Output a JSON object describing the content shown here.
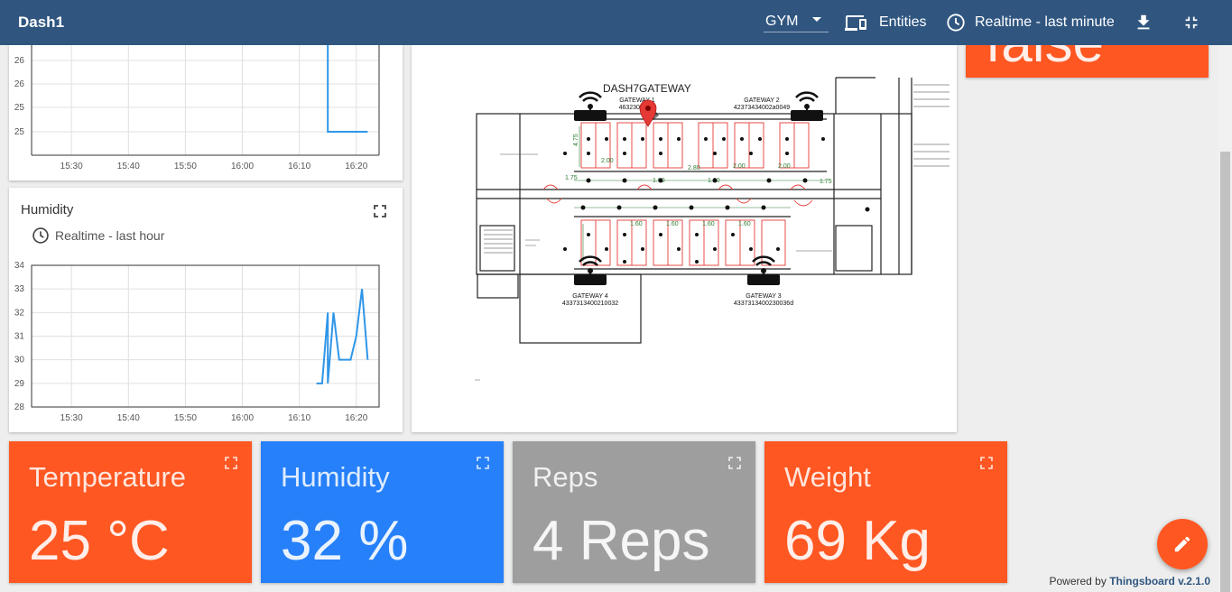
{
  "header": {
    "title": "Dash1",
    "entity_alias": "GYM",
    "entities_label": "Entities",
    "timewindow_label": "Realtime - last minute"
  },
  "temperature_chart": {
    "chart_data": {
      "type": "line",
      "x": [
        "16:14",
        "16:15",
        "16:15",
        "16:16",
        "16:17",
        "16:18",
        "16:19",
        "16:20",
        "16:21",
        "16:22"
      ],
      "series": [
        {
          "values": [
            27,
            27,
            25,
            25,
            25,
            25,
            25,
            25,
            25,
            25
          ]
        }
      ],
      "y_ticks": [
        "25",
        "25",
        "26",
        "26"
      ],
      "x_ticks": [
        "15:30",
        "15:40",
        "15:50",
        "16:00",
        "16:10",
        "16:20"
      ],
      "grid": true
    }
  },
  "humidity_chart": {
    "title": "Humidity",
    "timewindow": "Realtime - last hour",
    "chart_data": {
      "type": "line",
      "x": [
        "16:13",
        "16:14",
        "16:15",
        "16:15",
        "16:16",
        "16:17",
        "16:18",
        "16:19",
        "16:20",
        "16:21",
        "16:22"
      ],
      "series": [
        {
          "values": [
            29,
            29,
            32,
            29,
            32,
            30,
            30,
            30,
            31,
            33,
            30
          ]
        }
      ],
      "y_ticks": [
        "28",
        "29",
        "30",
        "31",
        "32",
        "33",
        "34"
      ],
      "x_ticks": [
        "15:30",
        "15:40",
        "15:50",
        "16:00",
        "16:10",
        "16:20"
      ],
      "ylim": [
        28,
        34
      ],
      "grid": true
    }
  },
  "floorplan": {
    "gateway_label": "DASH7GATEWAY",
    "gateways": [
      {
        "name": "GATEWAY 1",
        "id": "463230393..."
      },
      {
        "name": "GATEWAY 2",
        "id": "42373434002a0049"
      },
      {
        "name": "GATEWAY 3",
        "id": "4337313400230036d"
      },
      {
        "name": "GATEWAY 4",
        "id": "4337313400210032"
      }
    ],
    "dimensions": [
      "4.75",
      "2.00",
      "1.00",
      "2.80",
      "2.00",
      "2.00",
      "1.75",
      "1.75",
      "1.60",
      "1.60",
      "1.60",
      "1.60",
      "1.00"
    ]
  },
  "boolean_card": {
    "value": "false"
  },
  "value_cards": [
    {
      "title": "Temperature",
      "value": "25 °C",
      "color": "#ff5722"
    },
    {
      "title": "Humidity",
      "value": "32 %",
      "color": "#2680f9"
    },
    {
      "title": "Reps",
      "value": "4 Reps",
      "color": "#9e9e9e"
    },
    {
      "title": "Weight",
      "value": "69 Kg",
      "color": "#ff5722"
    }
  ],
  "footer": {
    "powered_prefix": "Powered by ",
    "powered_brand": "Thingsboard v.2.1.0"
  }
}
